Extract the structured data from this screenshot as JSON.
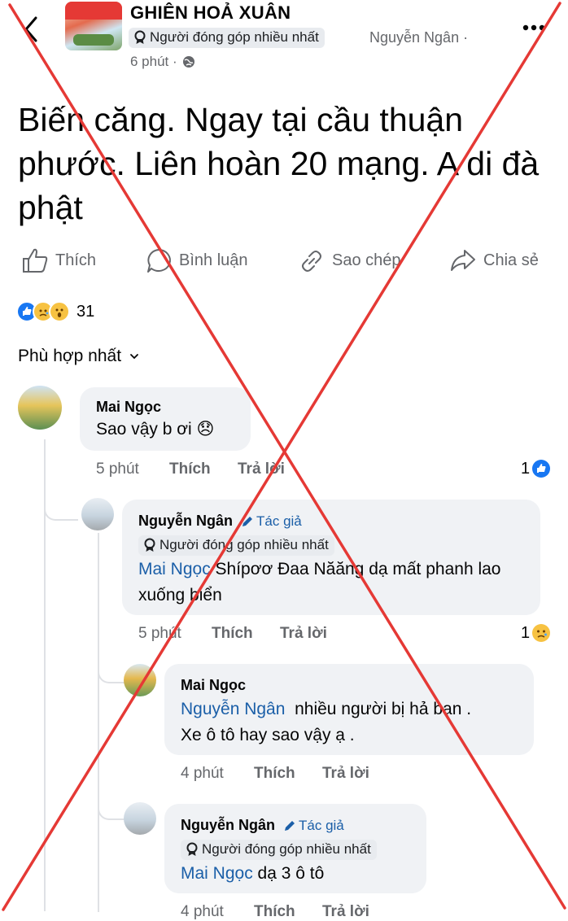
{
  "header": {
    "group_name": "GHIÊN HOẢ XUÂN",
    "badge": "Người đóng góp nhiều nhất",
    "author": "Nguyễn Ngân ·",
    "time": "6 phút ·",
    "icons": {
      "back": "chevron-left-icon",
      "more": "more-horizontal-icon",
      "privacy": "globe-icon"
    }
  },
  "post": {
    "text": "Biến căng. Ngay tại cầu thuận phước. Liên hoàn 20 mạng. A di đà phật"
  },
  "actions": {
    "like": "Thích",
    "comment": "Bình luận",
    "copy": "Sao chép",
    "share": "Chia sẻ"
  },
  "reactions": {
    "count": "31",
    "types": [
      "like",
      "sad",
      "wow"
    ],
    "colors": {
      "like": "#1877f2",
      "sad": "#f7c242",
      "wow": "#f7c242"
    }
  },
  "sort": {
    "label": "Phù hợp nhất"
  },
  "comments": [
    {
      "name": "Mai Ngọc",
      "text": "Sao vậy b ơi 😞",
      "time": "5 phút",
      "like": "Thích",
      "reply": "Trả lời",
      "reaction_count": "1"
    },
    {
      "name": "Nguyễn Ngân",
      "author_tag": "Tác giả",
      "badge": "Người đóng góp nhiều nhất",
      "mention": "Mai Ngọc",
      "text": " Shípơơ Đaa Năăng dạ mất phanh lao xuống biển",
      "time": "5 phút",
      "like": "Thích",
      "reply": "Trả lời",
      "reaction_count": "1"
    },
    {
      "name": "Mai Ngọc",
      "mention": "Nguyễn Ngân",
      "text_line1": "  nhiều người bị hả bạn .",
      "text_line2": "Xe ô tô hay sao vậy ạ .",
      "time": "4 phút",
      "like": "Thích",
      "reply": "Trả lời"
    },
    {
      "name": "Nguyễn Ngân",
      "author_tag": "Tác giả",
      "badge": "Người đóng góp nhiều nhất",
      "mention": "Mai Ngọc",
      "text": " dạ 3 ô tô",
      "time": "4 phút",
      "like": "Thích",
      "reply": "Trả lời"
    }
  ],
  "overlay": {
    "color": "#e53935",
    "shape": "red-x-mark"
  }
}
